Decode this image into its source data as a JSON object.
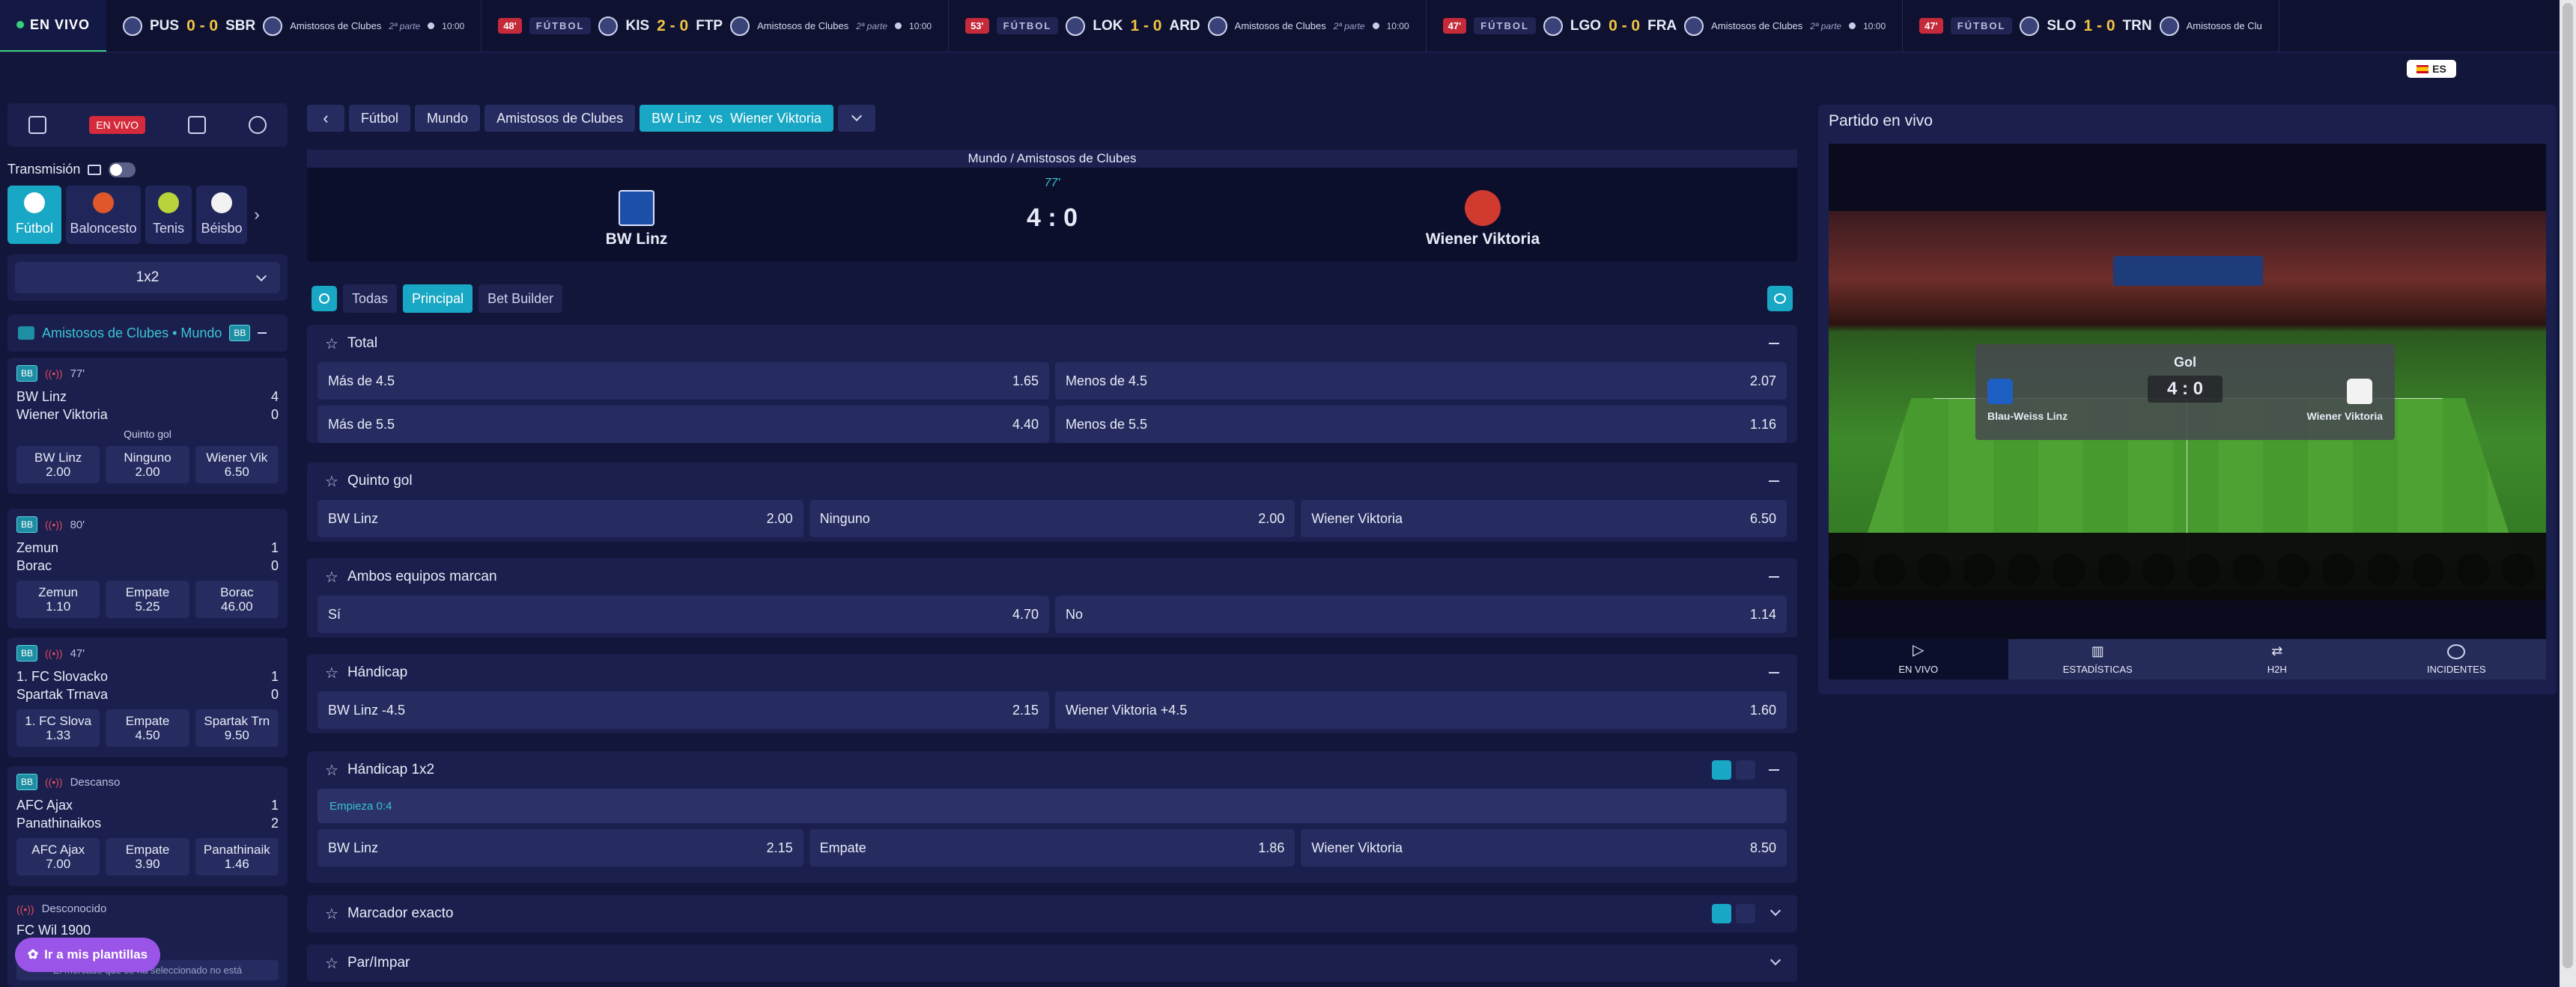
{
  "ticker": {
    "live_label": "EN VIVO",
    "items": [
      {
        "min": "",
        "sport": "",
        "home": "PUS",
        "score": "0 - 0",
        "away": "SBR",
        "comp": "Amistosos de Clubes",
        "part": "2ª parte",
        "time": "10:00"
      },
      {
        "min": "48'",
        "sport": "FÚTBOL",
        "home": "KIS",
        "score": "2 - 0",
        "away": "FTP",
        "comp": "Amistosos de Clubes",
        "part": "2ª parte",
        "time": "10:00"
      },
      {
        "min": "53'",
        "sport": "FÚTBOL",
        "home": "LOK",
        "score": "1 - 0",
        "away": "ARD",
        "comp": "Amistosos de Clubes",
        "part": "2ª parte",
        "time": "10:00"
      },
      {
        "min": "47'",
        "sport": "FÚTBOL",
        "home": "LGO",
        "score": "0 - 0",
        "away": "FRA",
        "comp": "Amistosos de Clubes",
        "part": "2ª parte",
        "time": "10:00"
      },
      {
        "min": "47'",
        "sport": "FÚTBOL",
        "home": "SLO",
        "score": "1 - 0",
        "away": "TRN",
        "comp": "Amistosos de Clu",
        "part": "",
        "time": ""
      }
    ]
  },
  "lang": "ES",
  "nav": {
    "live_badge": "EN VIVO"
  },
  "transmission_label": "Transmisión",
  "sports": [
    {
      "label": "Fútbol"
    },
    {
      "label": "Baloncesto"
    },
    {
      "label": "Tenis"
    },
    {
      "label": "Béisbo"
    }
  ],
  "market_selector": "1x2",
  "comp_header": "Amistosos de Clubes • Mundo",
  "bb": "BB",
  "matches": [
    {
      "status": "77'",
      "home": "BW Linz",
      "home_score": "4",
      "away": "Wiener Viktoria",
      "away_score": "0",
      "market": "Quinto gol",
      "odds": [
        {
          "l": "BW Linz",
          "v": "2.00"
        },
        {
          "l": "Ninguno",
          "v": "2.00"
        },
        {
          "l": "Wiener Vik",
          "v": "6.50"
        }
      ]
    },
    {
      "status": "80'",
      "home": "Zemun",
      "home_score": "1",
      "away": "Borac",
      "away_score": "0",
      "market": "",
      "odds": [
        {
          "l": "Zemun",
          "v": "1.10"
        },
        {
          "l": "Empate",
          "v": "5.25"
        },
        {
          "l": "Borac",
          "v": "46.00"
        }
      ]
    },
    {
      "status": "47'",
      "home": "1. FC Slovacko",
      "home_score": "1",
      "away": "Spartak Trnava",
      "away_score": "0",
      "market": "",
      "odds": [
        {
          "l": "1. FC Slova",
          "v": "1.33"
        },
        {
          "l": "Empate",
          "v": "4.50"
        },
        {
          "l": "Spartak Trn",
          "v": "9.50"
        }
      ]
    },
    {
      "status": "Descanso",
      "home": "AFC Ajax",
      "home_score": "1",
      "away": "Panathinaikos",
      "away_score": "2",
      "market": "",
      "odds": [
        {
          "l": "AFC Ajax",
          "v": "7.00"
        },
        {
          "l": "Empate",
          "v": "3.90"
        },
        {
          "l": "Panathinaik",
          "v": "1.46"
        }
      ]
    }
  ],
  "unknown_match": {
    "status": "Desconocido",
    "home": "FC Wil 1900",
    "note": "El mercado que se ha seleccionado no está"
  },
  "templates_btn": "Ir a mis plantillas",
  "breadcrumbs": [
    "Fútbol",
    "Mundo",
    "Amistosos de Clubes",
    "BW Linz  vs  Wiener Viktoria"
  ],
  "scoreboard": {
    "comp": "Mundo / Amistosos de Clubes",
    "minute": "77'",
    "score": "4 : 0",
    "home": "BW Linz",
    "away": "Wiener Viktoria"
  },
  "tabs": [
    "Todas",
    "Principal",
    "Bet Builder"
  ],
  "markets": {
    "total": {
      "title": "Total",
      "rows": [
        [
          {
            "l": "Más de 4.5",
            "v": "1.65"
          },
          {
            "l": "Menos de 4.5",
            "v": "2.07"
          }
        ],
        [
          {
            "l": "Más de 5.5",
            "v": "4.40"
          },
          {
            "l": "Menos de 5.5",
            "v": "1.16"
          }
        ]
      ]
    },
    "quinto": {
      "title": "Quinto gol",
      "rows": [
        [
          {
            "l": "BW Linz",
            "v": "2.00"
          },
          {
            "l": "Ninguno",
            "v": "2.00"
          },
          {
            "l": "Wiener Viktoria",
            "v": "6.50"
          }
        ]
      ]
    },
    "ambos": {
      "title": "Ambos equipos marcan",
      "rows": [
        [
          {
            "l": "Sí",
            "v": "4.70"
          },
          {
            "l": "No",
            "v": "1.14"
          }
        ]
      ]
    },
    "handicap": {
      "title": "Hándicap",
      "rows": [
        [
          {
            "l": "BW Linz -4.5",
            "v": "2.15"
          },
          {
            "l": "Wiener Viktoria +4.5",
            "v": "1.60"
          }
        ]
      ]
    },
    "handicap1x2": {
      "title": "Hándicap 1x2",
      "starts": "Empieza 0:4",
      "rows": [
        [
          {
            "l": "BW Linz",
            "v": "2.15"
          },
          {
            "l": "Empate",
            "v": "1.86"
          },
          {
            "l": "Wiener Viktoria",
            "v": "8.50"
          }
        ]
      ]
    },
    "exacto": {
      "title": "Marcador exacto"
    },
    "parimpar": {
      "title": "Par/Impar"
    }
  },
  "live_panel": {
    "title": "Partido en vivo",
    "goal": "Gol",
    "score": "4 : 0",
    "home": "Blau-Weiss Linz",
    "away": "Wiener Viktoria",
    "tabs": [
      "EN VIVO",
      "ESTADÍSTICAS",
      "H2H",
      "INCIDENTES"
    ]
  },
  "colors": {
    "accent": "#18a7c4",
    "live": "#d42a3b",
    "score": "#f4c443",
    "bg": "#12163a"
  }
}
